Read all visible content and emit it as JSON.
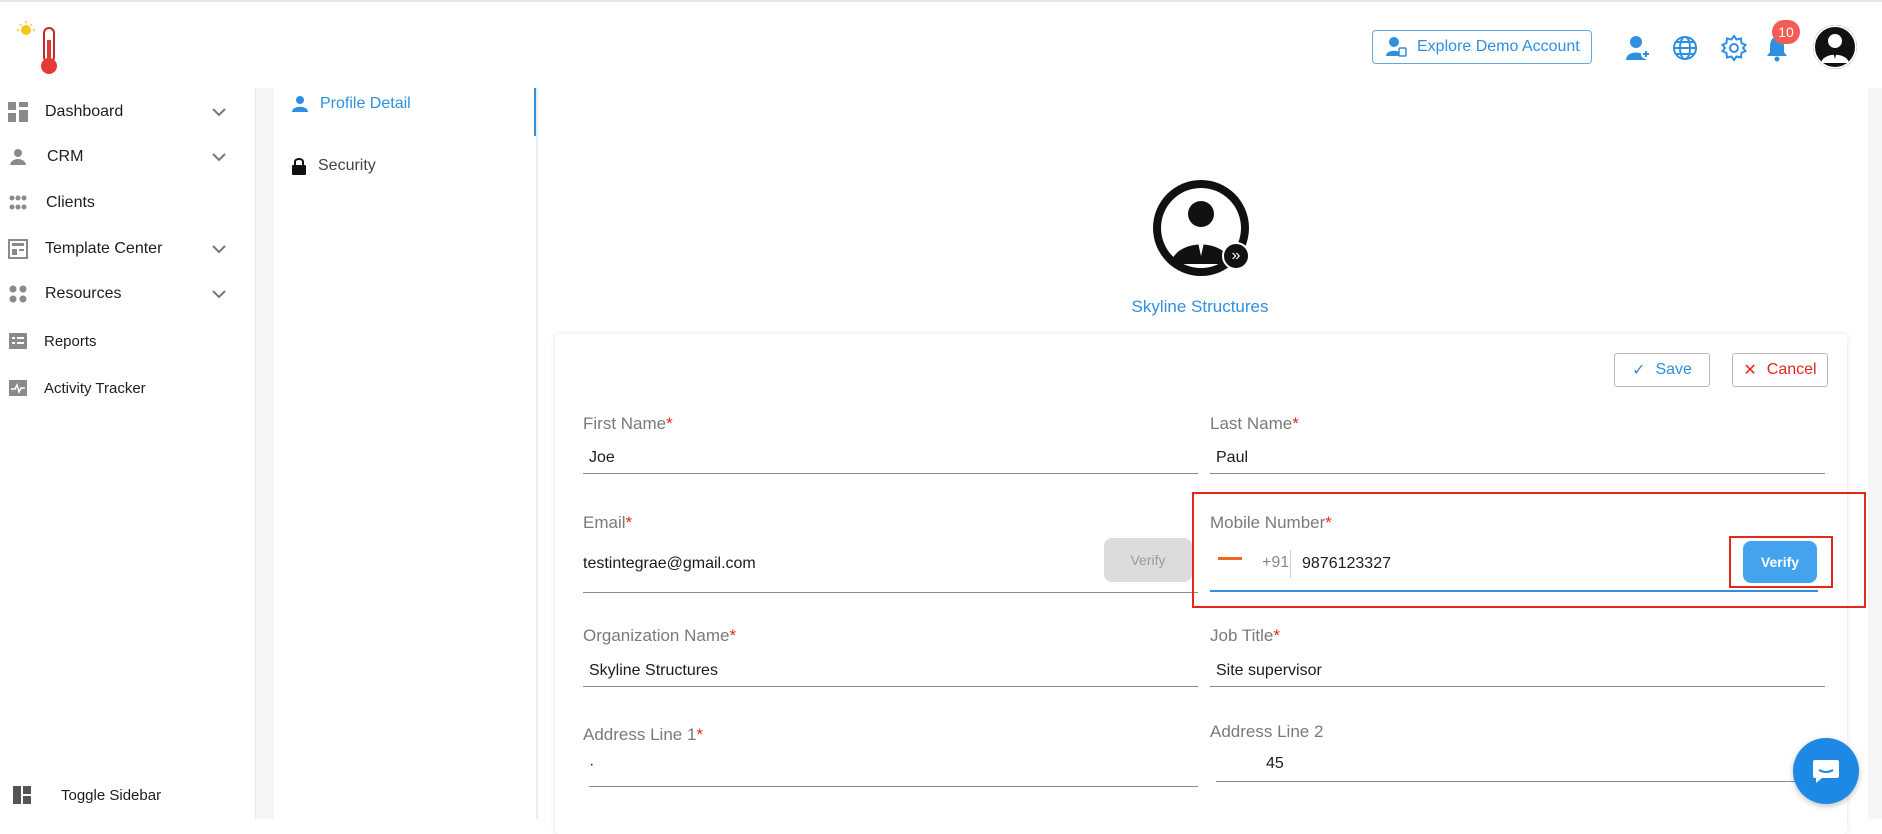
{
  "header": {
    "explore_label": "Explore Demo Account",
    "notification_count": "10"
  },
  "sidebar": {
    "items": [
      {
        "label": "Dashboard",
        "icon": "dashboard-icon",
        "has_chevron": true
      },
      {
        "label": "CRM",
        "icon": "crm-icon",
        "has_chevron": true
      },
      {
        "label": "Clients",
        "icon": "clients-icon",
        "has_chevron": false
      },
      {
        "label": "Template Center",
        "icon": "template-icon",
        "has_chevron": true
      },
      {
        "label": "Resources",
        "icon": "resources-icon",
        "has_chevron": true
      },
      {
        "label": "Reports",
        "icon": "reports-icon",
        "has_chevron": false
      },
      {
        "label": "Activity Tracker",
        "icon": "activity-icon",
        "has_chevron": false
      }
    ],
    "toggle_label": "Toggle Sidebar"
  },
  "subnav": {
    "items": [
      {
        "label": "Profile Detail",
        "active": true
      },
      {
        "label": "Security",
        "active": false
      }
    ]
  },
  "profile": {
    "organization_title": "Skyline Structures"
  },
  "form": {
    "save_label": "Save",
    "cancel_label": "Cancel",
    "first_name": {
      "label": "First Name",
      "required": "*",
      "value": "Joe"
    },
    "last_name": {
      "label": "Last Name",
      "required": "*",
      "value": "Paul"
    },
    "email": {
      "label": "Email",
      "required": "*",
      "value": "testintegrae@gmail.com",
      "verify_label": "Verify"
    },
    "mobile": {
      "label": "Mobile Number",
      "required": "*",
      "country_code": "+91",
      "value": "9876123327",
      "verify_label": "Verify"
    },
    "organization": {
      "label": "Organization Name",
      "required": "*",
      "value": "Skyline Structures"
    },
    "job_title": {
      "label": "Job Title",
      "required": "*",
      "value": "Site supervisor"
    },
    "address1": {
      "label": "Address Line 1",
      "required": "*",
      "value": "·"
    },
    "address2": {
      "label": "Address Line 2",
      "value": "45"
    }
  },
  "colors": {
    "accent": "#2f8fe0",
    "required": "#e5271b",
    "highlight": "#e5271b",
    "verify_active": "#44a3ef"
  }
}
